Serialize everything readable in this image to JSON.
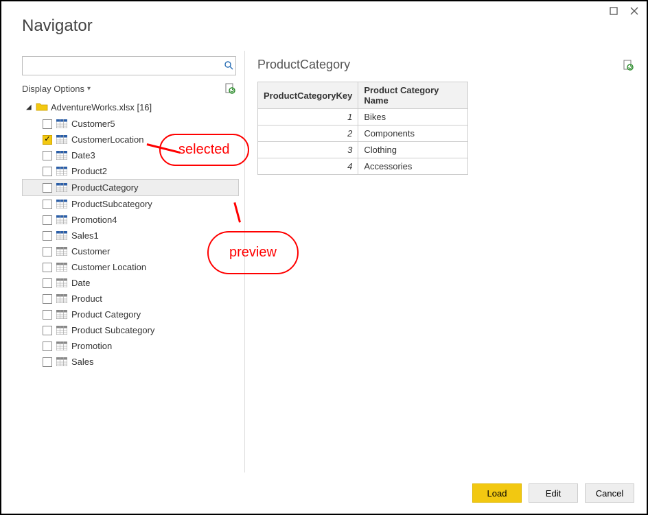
{
  "window": {
    "title": "Navigator"
  },
  "search": {
    "value": "",
    "placeholder": ""
  },
  "display_options_label": "Display Options",
  "tree": {
    "root_label": "AdventureWorks.xlsx [16]",
    "items": [
      {
        "label": "Customer5",
        "checked": false,
        "type": "table-blue",
        "highlighted": false
      },
      {
        "label": "CustomerLocation",
        "checked": true,
        "type": "table-blue",
        "highlighted": false
      },
      {
        "label": "Date3",
        "checked": false,
        "type": "table-blue",
        "highlighted": false
      },
      {
        "label": "Product2",
        "checked": false,
        "type": "table-blue",
        "highlighted": false
      },
      {
        "label": "ProductCategory",
        "checked": false,
        "type": "table-blue",
        "highlighted": true
      },
      {
        "label": "ProductSubcategory",
        "checked": false,
        "type": "table-blue",
        "highlighted": false
      },
      {
        "label": "Promotion4",
        "checked": false,
        "type": "table-blue",
        "highlighted": false
      },
      {
        "label": "Sales1",
        "checked": false,
        "type": "table-blue",
        "highlighted": false
      },
      {
        "label": "Customer",
        "checked": false,
        "type": "table-grey",
        "highlighted": false
      },
      {
        "label": "Customer Location",
        "checked": false,
        "type": "table-grey",
        "highlighted": false
      },
      {
        "label": "Date",
        "checked": false,
        "type": "table-grey",
        "highlighted": false
      },
      {
        "label": "Product",
        "checked": false,
        "type": "table-grey",
        "highlighted": false
      },
      {
        "label": "Product Category",
        "checked": false,
        "type": "table-grey",
        "highlighted": false
      },
      {
        "label": "Product Subcategory",
        "checked": false,
        "type": "table-grey",
        "highlighted": false
      },
      {
        "label": "Promotion",
        "checked": false,
        "type": "table-grey",
        "highlighted": false
      },
      {
        "label": "Sales",
        "checked": false,
        "type": "table-grey",
        "highlighted": false
      }
    ]
  },
  "preview": {
    "title": "ProductCategory",
    "columns": [
      "ProductCategoryKey",
      "Product Category Name"
    ],
    "rows": [
      {
        "key": "1",
        "name": "Bikes"
      },
      {
        "key": "2",
        "name": "Components"
      },
      {
        "key": "3",
        "name": "Clothing"
      },
      {
        "key": "4",
        "name": "Accessories"
      }
    ]
  },
  "footer": {
    "load": "Load",
    "edit": "Edit",
    "cancel": "Cancel"
  },
  "annotations": {
    "selected": "selected",
    "preview": "preview"
  }
}
